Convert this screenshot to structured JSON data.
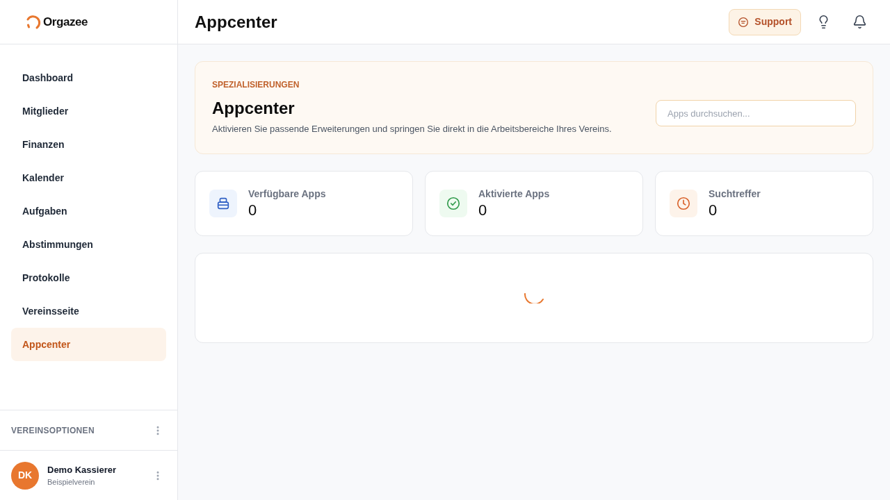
{
  "brand": {
    "name": "Orgazee"
  },
  "sidebar": {
    "items": [
      {
        "label": "Dashboard",
        "selected": false
      },
      {
        "label": "Mitglieder",
        "selected": false
      },
      {
        "label": "Finanzen",
        "selected": false
      },
      {
        "label": "Kalender",
        "selected": false
      },
      {
        "label": "Aufgaben",
        "selected": false
      },
      {
        "label": "Abstimmungen",
        "selected": false
      },
      {
        "label": "Protokolle",
        "selected": false
      },
      {
        "label": "Vereinsseite",
        "selected": false
      },
      {
        "label": "Appcenter",
        "selected": true
      }
    ],
    "section": {
      "title": "VEREINSOPTIONEN"
    },
    "user": {
      "initials": "DK",
      "name": "Demo Kassierer",
      "organization": "Beispielverein"
    }
  },
  "header": {
    "title": "Appcenter",
    "support_button": "Support"
  },
  "hero": {
    "eyebrow": "SPEZIALISIERUNGEN",
    "title": "Appcenter",
    "description": "Aktivieren Sie passende Erweiterungen und springen Sie direkt in die Arbeitsbereiche Ihres Vereins.",
    "search": {
      "placeholder": "Apps durchsuchen..."
    }
  },
  "stats": [
    {
      "kind": "available",
      "label": "Verfügbare Apps",
      "value": "0"
    },
    {
      "kind": "activated",
      "label": "Aktivierte Apps",
      "value": "0"
    },
    {
      "kind": "matches",
      "label": "Suchtreffer",
      "value": "0"
    }
  ],
  "results": {
    "loading": true
  }
}
